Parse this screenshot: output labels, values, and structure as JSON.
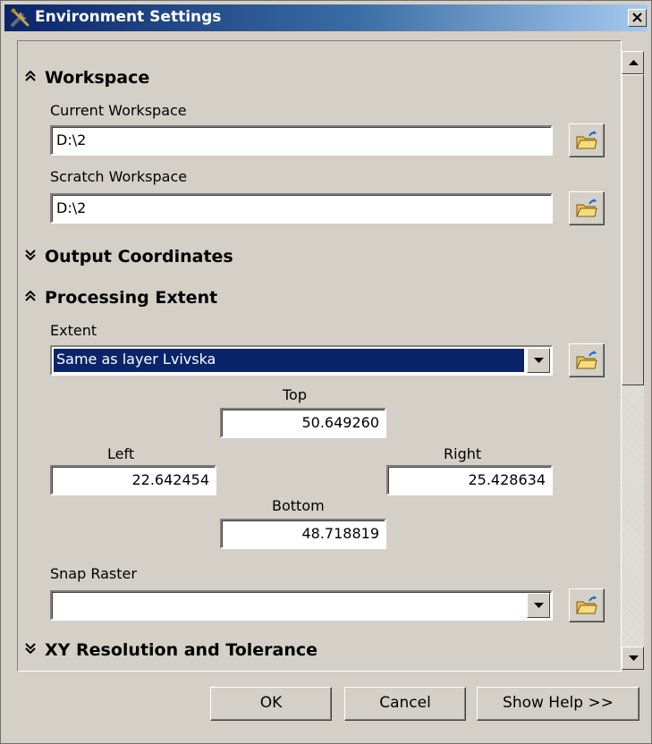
{
  "window": {
    "title": "Environment Settings",
    "close_label": "×"
  },
  "sections": {
    "workspace": {
      "header": "Workspace",
      "state": "expanded",
      "current_workspace": {
        "label": "Current Workspace",
        "value": "D:\\2"
      },
      "scratch_workspace": {
        "label": "Scratch Workspace",
        "value": "D:\\2"
      }
    },
    "output_coordinates": {
      "header": "Output Coordinates",
      "state": "collapsed"
    },
    "processing_extent": {
      "header": "Processing Extent",
      "state": "expanded",
      "extent_label": "Extent",
      "extent_value": "Same as layer Lvivska",
      "top": {
        "label": "Top",
        "value": "50.649260"
      },
      "left": {
        "label": "Left",
        "value": "22.642454"
      },
      "right": {
        "label": "Right",
        "value": "25.428634"
      },
      "bottom": {
        "label": "Bottom",
        "value": "48.718819"
      },
      "snap_raster": {
        "label": "Snap Raster",
        "value": ""
      }
    },
    "xy_resolution": {
      "header": "XY Resolution and Tolerance",
      "state": "collapsed"
    }
  },
  "buttons": {
    "ok": "OK",
    "cancel": "Cancel",
    "help": "Show Help >>"
  },
  "colors": {
    "dialog_bg": "#d4d0c8",
    "title_start": "#0a246a",
    "title_end": "#a6caf0",
    "selection": "#0a246a"
  },
  "icons": {
    "title": "tools-icon",
    "browse": "open-folder-icon",
    "expanded": "chevron-double-up-icon",
    "collapsed": "chevron-double-down-icon"
  }
}
